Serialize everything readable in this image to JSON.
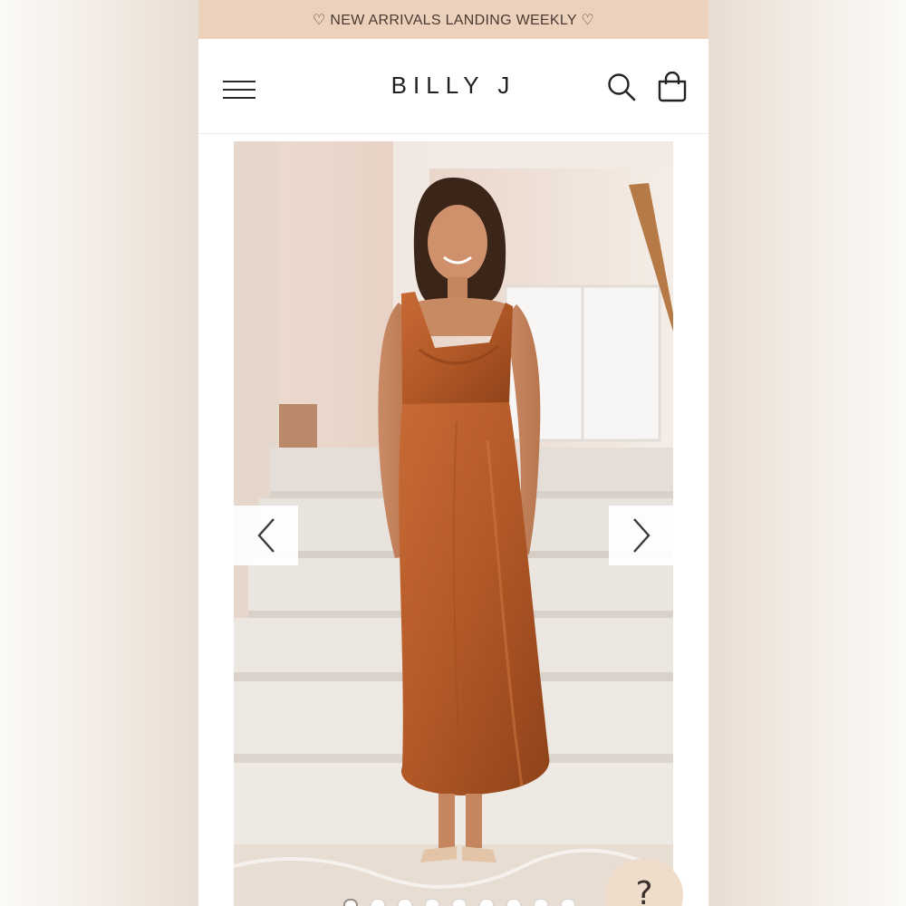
{
  "promo": {
    "text": "♡ NEW ARRIVALS LANDING WEEKLY ♡"
  },
  "header": {
    "brand": "BILLY J",
    "icons": [
      "menu-icon",
      "search-icon",
      "shopping-bag-icon"
    ]
  },
  "gallery": {
    "image": "model wearing rust satin cowl-neck midi dress on stairs",
    "prev_icon": "chevron-left-icon",
    "next_icon": "chevron-right-icon",
    "total_slides": 9,
    "active_slide": 1
  },
  "help": {
    "label": "?"
  },
  "colors": {
    "promo_bg": "#ecd2bd",
    "dress": "#b45a28",
    "help_bg": "#f0dccb"
  }
}
